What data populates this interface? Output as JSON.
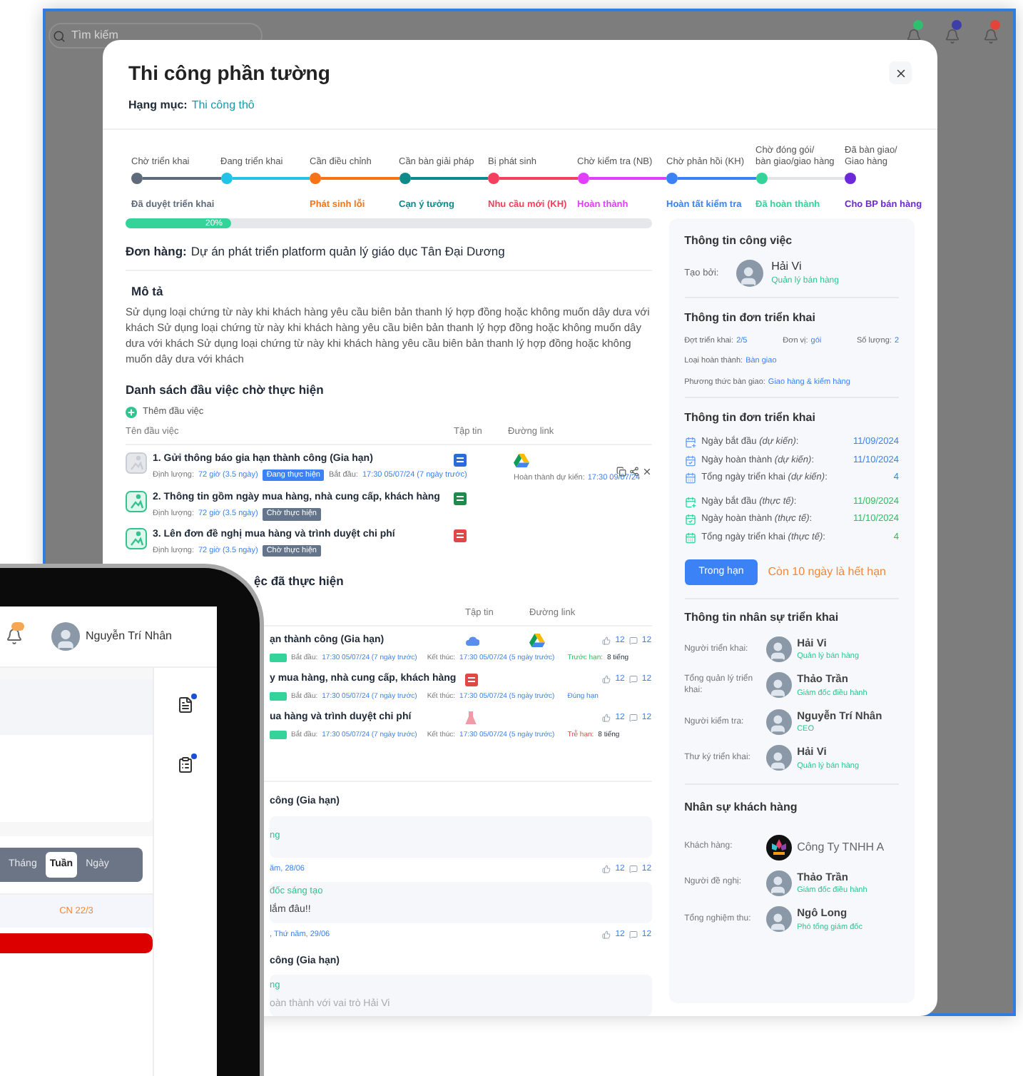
{
  "backdrop": {
    "search_placeholder": "Tìm kiếm"
  },
  "modal": {
    "title": "Thi công phần tường",
    "category_label": "Hạng mục:",
    "category": "Thi công thô"
  },
  "stepper": [
    {
      "label": "Chờ triển khai",
      "status": "Đã duyệt triển khai",
      "color": "#5f6b7a",
      "completed": true
    },
    {
      "label": "Đang triển khai",
      "color": "#22c3e6",
      "completed": true
    },
    {
      "label": "Cần điều chỉnh",
      "status": "Phát sinh lỗi",
      "color": "#f97316",
      "completed": true
    },
    {
      "label": "Cần bàn giải pháp",
      "status": "Cạn ý tưởng",
      "color": "#0f8a8a",
      "completed": true
    },
    {
      "label": "Bị phát sinh",
      "status": "Nhu cầu mới (KH)",
      "color": "#f43f5e",
      "completed": true
    },
    {
      "label": "Chờ kiểm tra (NB)",
      "status": "Hoàn thành",
      "color": "#e040fb",
      "completed": true
    },
    {
      "label": "Chờ phản hồi (KH)",
      "status": "Hoàn tất kiểm tra",
      "color": "#3b82f6",
      "completed": true
    },
    {
      "label": "Chờ đóng gói/\nbàn giao/giao hàng",
      "status": "Đã hoàn thành",
      "color": "#34d399",
      "completed": false
    },
    {
      "label": "Đã bàn giao/\nGiao hàng",
      "status": "Cho BP bán hàng",
      "color": "#6d28d9"
    }
  ],
  "progress": {
    "level": 0.2,
    "label": "20%"
  },
  "order": {
    "label": "Đơn hàng:",
    "value": "Dự án phát triển platform quản lý giáo dục Tân Đại Dương"
  },
  "description": {
    "title": "Mô tả",
    "text": "Sử dụng loại chứng từ này khi khách hàng yêu cầu biên bản thanh lý hợp đồng hoặc không muốn dây dưa với khách Sử dụng loại chứng từ này khi khách hàng yêu cầu biên bản thanh lý hợp đồng hoặc không muốn dây dưa với khách Sử dụng loại chứng từ này khi khách hàng yêu cầu biên bản thanh lý hợp đồng hoặc không muốn dây dưa với khách"
  },
  "pending_tasks": {
    "title": "Danh sách đầu việc chờ thực hiện",
    "add_label": "Thêm đầu việc",
    "columns": [
      "Tên đầu việc",
      "Tập tin",
      "Đường link"
    ],
    "rows": [
      {
        "name": "1. Gửi thông báo gia hạn thành công (Gia hạn)",
        "quota_label": "Định lượng:",
        "quota": "72 giờ (3.5 ngày)",
        "status": "Đang thực hiện",
        "kind": "in_progress",
        "start_label": "Bắt đầu:",
        "start": "17:30 05/07/24 (7 ngày trước)",
        "due_label": "Hoàn thành dự kiến:",
        "due": "17:30 09/07/24",
        "actions": true
      },
      {
        "name": "2. Thông tin gồm ngày mua hàng, nhà cung cấp, khách hàng",
        "quota_label": "Định lượng:",
        "quota": "72 giờ (3.5 ngày)",
        "status": "Chờ thực hiện",
        "kind": "pending",
        "actions": false
      },
      {
        "name": "3. Lên đơn đề nghị mua hàng và trình duyệt chi phí",
        "quota_label": "Định lượng:",
        "quota": "72 giờ (3.5 ngày)",
        "status": "Chờ thực hiện",
        "kind": "pending",
        "actions": false
      }
    ]
  },
  "done_tasks": {
    "title": "ệc đã thực hiện",
    "columns": [
      "Tập tin",
      "Đường link"
    ],
    "rows": [
      {
        "name": "ạn thành công (Gia hạn)",
        "start_label": "Bắt đầu:",
        "start": "17:30 05/07/24 (7 ngày trước)",
        "end_label": "Kết thúc:",
        "end": "17:30 05/07/24 (5 ngày trước)",
        "kind": "early",
        "status_label": "Trước hạn:",
        "status_value": "8 tiếng",
        "likes": "12",
        "comments": "12"
      },
      {
        "name": "y mua hàng, nhà cung cấp, khách hàng",
        "start_label": "Bắt đầu:",
        "start": "17:30 05/07/24 (7 ngày trước)",
        "end_label": "Kết thúc:",
        "end": "17:30 05/07/24 (5 ngày trước)",
        "kind": "ontime",
        "status_label": "Đúng hạn",
        "likes": "12",
        "comments": "12"
      },
      {
        "name": "ua hàng và trình duyệt chi phí",
        "start_label": "Bắt đầu:",
        "start": "17:30 05/07/24 (7 ngày trước)",
        "end_label": "Kết thúc:",
        "end": "17:30 05/07/24 (5 ngày trước)",
        "kind": "late",
        "status_label": "Trễ hạn:",
        "status_value": "8 tiếng",
        "likes": "12",
        "comments": "12"
      }
    ]
  },
  "comments": [
    {
      "title": "công (Gia hạn)",
      "author": "ng",
      "date": "ăm, 28/06",
      "likes": "12",
      "replies": "12"
    },
    {
      "author": "đốc sáng tạo",
      "text": "lắm đâu!!",
      "date": ", Thứ năm, 29/06",
      "likes": "12",
      "replies": "12"
    },
    {
      "title": "công (Gia hạn)",
      "author": "ng",
      "text": "oàn thành với vai trò Hải Vi"
    }
  ],
  "job_info": {
    "title": "Thông tin công việc",
    "created_label": "Tạo bởi:",
    "name": "Hải Vi",
    "role": "Quản lý bán hàng"
  },
  "deploy_info": {
    "title": "Thông tin đơn triển khai",
    "fields": [
      {
        "label": "Đợt triển khai:",
        "value": "2/5"
      },
      {
        "label": "Đơn vị:",
        "value": "gói"
      },
      {
        "label": "Số lượng:",
        "value": "2"
      }
    ],
    "lines": [
      {
        "label": "Loại hoàn thành:",
        "value": "Bàn giao"
      },
      {
        "label": "Phương thức bàn giao:",
        "value": "Giao hàng & kiểm hàng"
      }
    ]
  },
  "schedule": {
    "title": "Thông tin đơn triển khai",
    "rows": [
      {
        "label": "Ngày bắt đầu *(dự kiến)*:",
        "value": "11/09/2024",
        "kind": "planned"
      },
      {
        "label": "Ngày hoàn thành *(dự kiến)*:",
        "value": "11/10/2024",
        "kind": "planned"
      },
      {
        "label": "Tổng ngày triển khai *(dự kiến)*:",
        "value": "4",
        "kind": "planned"
      },
      {
        "label": "Ngày bắt đầu *(thực tế)*:",
        "value": "11/09/2024",
        "kind": "actual"
      },
      {
        "label": "Ngày hoàn thành *(thực tế)*:",
        "value": "11/10/2024",
        "kind": "actual"
      },
      {
        "label": "Tổng ngày triển khai *(thực tế)*:",
        "value": "4",
        "kind": "actual"
      }
    ],
    "badge": "Trong hạn",
    "remaining": "Còn 10 ngày là hết hạn"
  },
  "staff": {
    "title": "Thông tin nhân sự triển khai",
    "rows": [
      {
        "label": "Người triển khai:",
        "name": "Hải Vi",
        "role": "Quản lý bán hàng"
      },
      {
        "label": "Tổng quản lý triển khai:",
        "name": "Thảo Trần",
        "role": "Giám đốc điều hành"
      },
      {
        "label": "Người kiểm tra:",
        "name": "Nguyễn Trí Nhân",
        "role": "CEO"
      },
      {
        "label": "Thư ký triển khai:",
        "name": "Hải Vi",
        "role": "Quản lý bán hàng"
      }
    ]
  },
  "customer": {
    "title": "Nhân sự khách hàng",
    "rows": [
      {
        "label": "Khách hàng:",
        "name": "Công Ty TNHH A",
        "kind": "company"
      },
      {
        "label": "Người đề nghị:",
        "name": "Thảo Trần",
        "role": "Giám đốc điều hành",
        "kind": "person"
      },
      {
        "label": "Tổng nghiệm thu:",
        "name": "Ngô Long",
        "role": "Phó tổng giám đốc",
        "kind": "person"
      }
    ]
  },
  "phone": {
    "user": "Nguyễn Trí Nhân",
    "tabs": [
      {
        "label": "Tháng",
        "selected": false
      },
      {
        "label": "Tuần",
        "selected": true
      },
      {
        "label": "Ngày",
        "selected": false
      }
    ],
    "day": "CN 22/3"
  }
}
